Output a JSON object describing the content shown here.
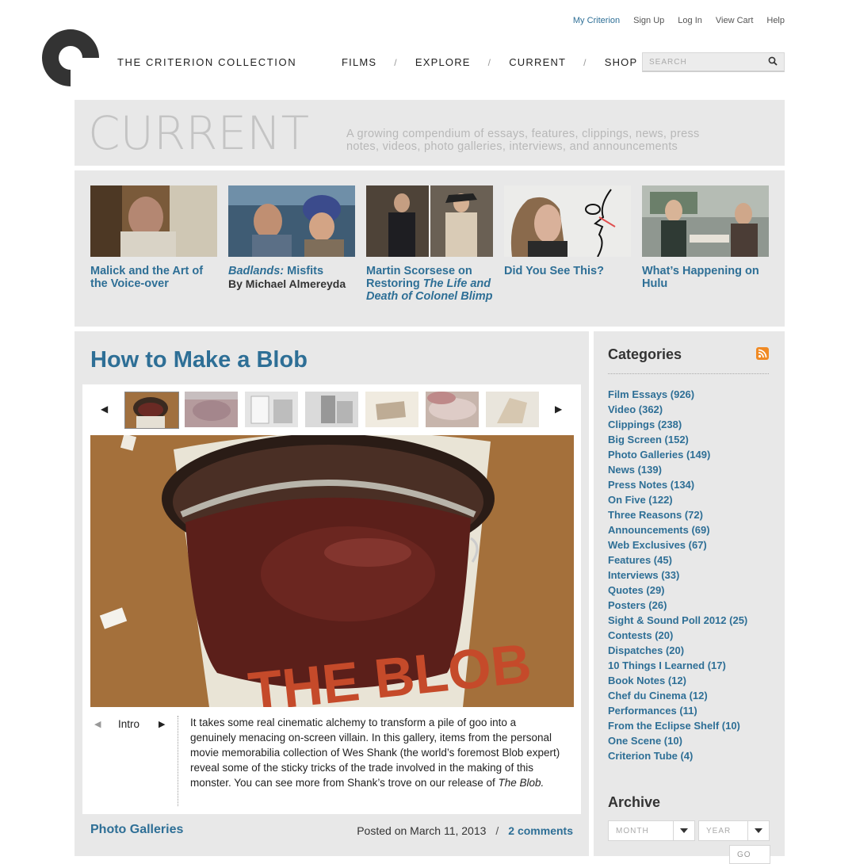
{
  "util_nav": [
    "My Criterion",
    "Sign Up",
    "Log In",
    "View Cart",
    "Help"
  ],
  "brand": "THE CRITERION COLLECTION",
  "main_nav": [
    "FILMS",
    "EXPLORE",
    "CURRENT",
    "SHOP"
  ],
  "main_nav_separator": "/",
  "search": {
    "placeholder": "SEARCH"
  },
  "banner": {
    "title": "CURRENT",
    "description": "A growing compendium of essays, features, clippings, news, press notes, videos, photo galleries, interviews, and announcements"
  },
  "features": [
    {
      "title": "Malick and the Art of the Voice-over"
    },
    {
      "title_italic": "Badlands:",
      "title": "Misfits",
      "byline": "By Michael Almereyda"
    },
    {
      "title": "Martin Scorsese on Restoring",
      "title_italic": "The Life and Death of Colonel Blimp"
    },
    {
      "title": "Did You See This?"
    },
    {
      "title": "What’s Happening on Hulu"
    }
  ],
  "article": {
    "title": "How to Make a Blob",
    "caption_label": "Intro",
    "caption_text": "It takes some real cinematic alchemy to transform a pile of goo into a genuinely menacing on-screen villain. In this gallery, items from the personal movie memorabilia collection of Wes Shank (the world’s foremost Blob expert) reveal some of the sticky tricks of the trade involved in the making of this monster. You can see more from Shank’s trove on our release of",
    "caption_italic": "The Blob.",
    "category": "Photo Galleries",
    "posted": "Posted on March 11, 2013",
    "comments": "2 comments",
    "can_text": "THE BLOB"
  },
  "sidebar": {
    "categories_title": "Categories",
    "categories": [
      "Film Essays (926)",
      "Video (362)",
      "Clippings (238)",
      "Big Screen (152)",
      "Photo Galleries (149)",
      "News (139)",
      "Press Notes (134)",
      "On Five (122)",
      "Three Reasons (72)",
      "Announcements (69)",
      "Web Exclusives (67)",
      "Features (45)",
      "Interviews (33)",
      "Quotes (29)",
      "Posters (26)",
      "Sight & Sound Poll 2012 (25)",
      "Contests (20)",
      "Dispatches (20)",
      "10 Things I Learned (17)",
      "Book Notes (12)",
      "Chef du Cinema (12)",
      "Performances (11)",
      "From the Eclipse Shelf (10)",
      "One Scene (10)",
      "Criterion Tube (4)"
    ],
    "archive_title": "Archive",
    "month_label": "MONTH",
    "year_label": "YEAR",
    "go_label": "GO"
  },
  "colors": {
    "link": "#2e6f96",
    "panel": "#e8e8e8",
    "rss": "#f08a24"
  },
  "icons": [
    "criterion-logo",
    "search-icon",
    "rss-icon",
    "prev-arrow-icon",
    "next-arrow-icon",
    "dropdown-arrow-icon"
  ]
}
